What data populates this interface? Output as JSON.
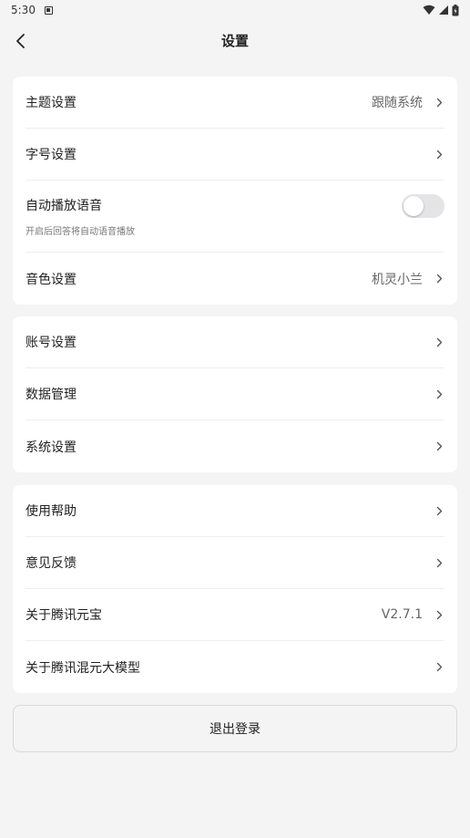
{
  "status_bar": {
    "time": "5:30"
  },
  "header": {
    "title": "设置"
  },
  "groups": [
    {
      "items": [
        {
          "label": "主题设置",
          "value": "跟随系统"
        },
        {
          "label": "字号设置",
          "value": ""
        },
        {
          "label": "自动播放语音",
          "sub": "开启后回答将自动语音播放",
          "toggle": false
        },
        {
          "label": "音色设置",
          "value": "机灵小兰"
        }
      ]
    },
    {
      "items": [
        {
          "label": "账号设置"
        },
        {
          "label": "数据管理"
        },
        {
          "label": "系统设置"
        }
      ]
    },
    {
      "items": [
        {
          "label": "使用帮助"
        },
        {
          "label": "意见反馈"
        },
        {
          "label": "关于腾讯元宝",
          "value": "V2.7.1"
        },
        {
          "label": "关于腾讯混元大模型"
        }
      ]
    }
  ],
  "logout": {
    "label": "退出登录"
  },
  "icons": {
    "back": "chevron-left-icon",
    "row_arrow": "chevron-right-icon",
    "wifi": "wifi-icon",
    "signal": "signal-icon",
    "battery": "battery-icon",
    "notification": "app-notification-icon"
  },
  "colors": {
    "background": "#f4f4f5",
    "card": "#ffffff",
    "toggle_off": "#e4e4e6"
  }
}
